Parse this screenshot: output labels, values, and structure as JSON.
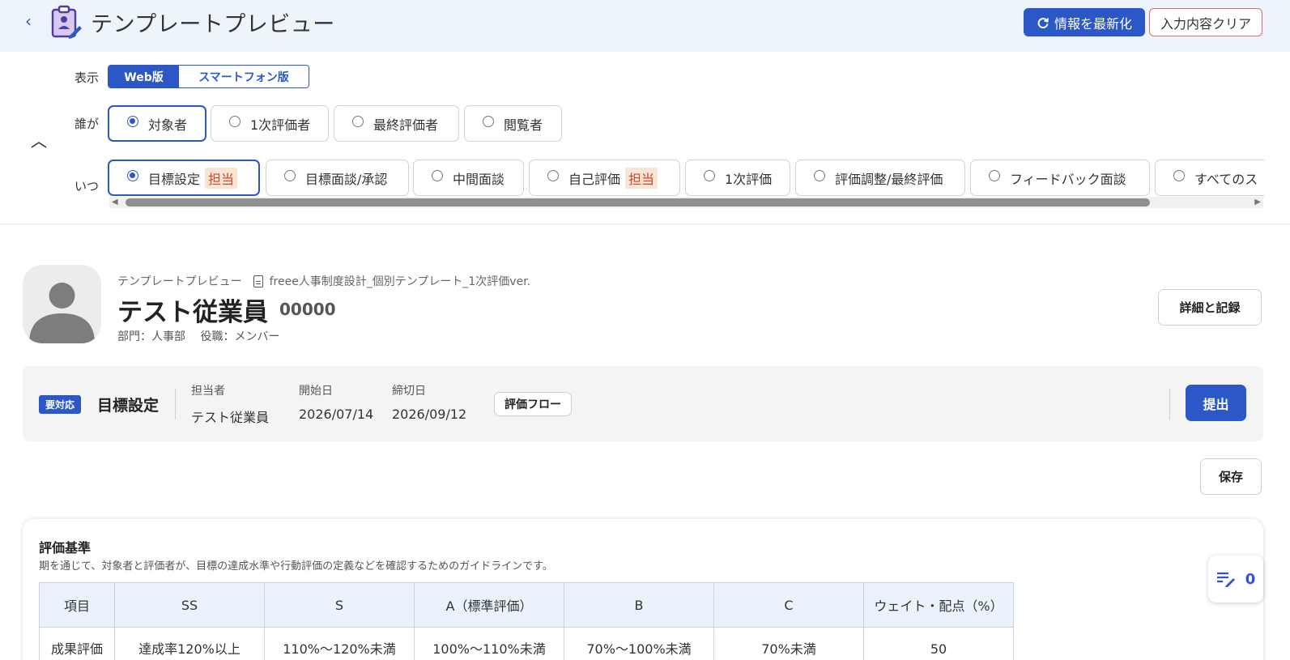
{
  "header": {
    "title": "テンプレートプレビュー",
    "refresh_label": "情報を最新化",
    "clear_label": "入力内容クリア"
  },
  "filters": {
    "display_label": "表示",
    "display_options": [
      "Web版",
      "スマートフォン版"
    ],
    "display_selected": "Web版",
    "who_label": "誰が",
    "who_options": [
      "対象者",
      "1次評価者",
      "最終評価者",
      "閲覧者"
    ],
    "who_selected": "対象者",
    "when_label": "いつ",
    "when_options": [
      {
        "label": "目標設定",
        "tag": "担当"
      },
      {
        "label": "目標面談/承認",
        "tag": ""
      },
      {
        "label": "中間面談",
        "tag": ""
      },
      {
        "label": "自己評価",
        "tag": "担当"
      },
      {
        "label": "1次評価",
        "tag": ""
      },
      {
        "label": "評価調整/最終評価",
        "tag": ""
      },
      {
        "label": "フィードバック面談",
        "tag": ""
      },
      {
        "label": "すべてのス",
        "tag": ""
      }
    ],
    "when_selected": "目標設定"
  },
  "employee": {
    "breadcrumb": "テンプレートプレビュー",
    "template_name": "freee人事制度設計_個別テンプレート_1次評価ver.",
    "name": "テスト従業員",
    "code": "00000",
    "meta": "部門：人事部　 役職：メンバー",
    "detail_button": "詳細と記録"
  },
  "stage": {
    "badge": "要対応",
    "title": "目標設定",
    "assignee_label": "担当者",
    "assignee": "テスト従業員",
    "start_label": "開始日",
    "start": "2026/07/14",
    "due_label": "締切日",
    "due": "2026/09/12",
    "flow_button": "評価フロー",
    "submit_button": "提出"
  },
  "save_button": "保存",
  "criteria": {
    "title": "評価基準",
    "description": "期を通じて、対象者と評価者が、目標の達成水準や行動評価の定義などを確認するためのガイドラインです。",
    "headers": [
      "項目",
      "SS",
      "S",
      "A（標準評価）",
      "B",
      "C",
      "ウェイト・配点（%）"
    ],
    "rows": [
      [
        "成果評価（達成度）",
        "達成率120%以上",
        "110%～120%未満",
        "100%～110%未満",
        "70%～100%未満",
        "70%未満",
        "50"
      ]
    ]
  },
  "comments": {
    "count": "0"
  },
  "colors": {
    "accent": "#2b57c7",
    "header_bg": "#eef4fc",
    "tag_bg": "#fbe3d6",
    "tag_text": "#c9492c"
  }
}
